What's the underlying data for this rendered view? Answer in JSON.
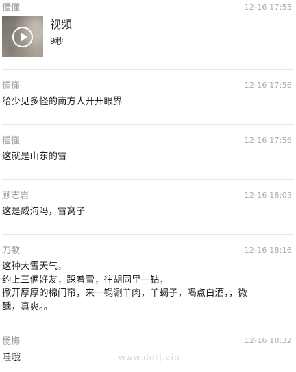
{
  "messages": [
    {
      "sender": "懂懂",
      "time": "12-16 17:55",
      "video": {
        "title": "视频",
        "duration": "9秒",
        "icon": "play-icon"
      }
    },
    {
      "sender": "懂懂",
      "time": "12-16 17:56",
      "text": "给少见多怪的南方人开开眼界"
    },
    {
      "sender": "懂懂",
      "time": "12-16 17:56",
      "text": "这就是山东的雪"
    },
    {
      "sender": "顾志岩",
      "time": "12-16 18:05",
      "text": "这是威海吗，雪窝子"
    },
    {
      "sender": "刀歌",
      "time": "12-16 18:16",
      "lines": [
        "这种大雪天气，",
        "约上三俩好友，踩着雪，往胡同里一钻，",
        "掀开厚厚的棉门帘，来一锅涮羊肉，羊蝎子，喝点白酒，，微",
        "醺，真爽。。"
      ]
    },
    {
      "sender": "杨梅",
      "time": "12-16 18:32",
      "text": "哇哦"
    }
  ],
  "watermark": "www.ddrj.vip"
}
